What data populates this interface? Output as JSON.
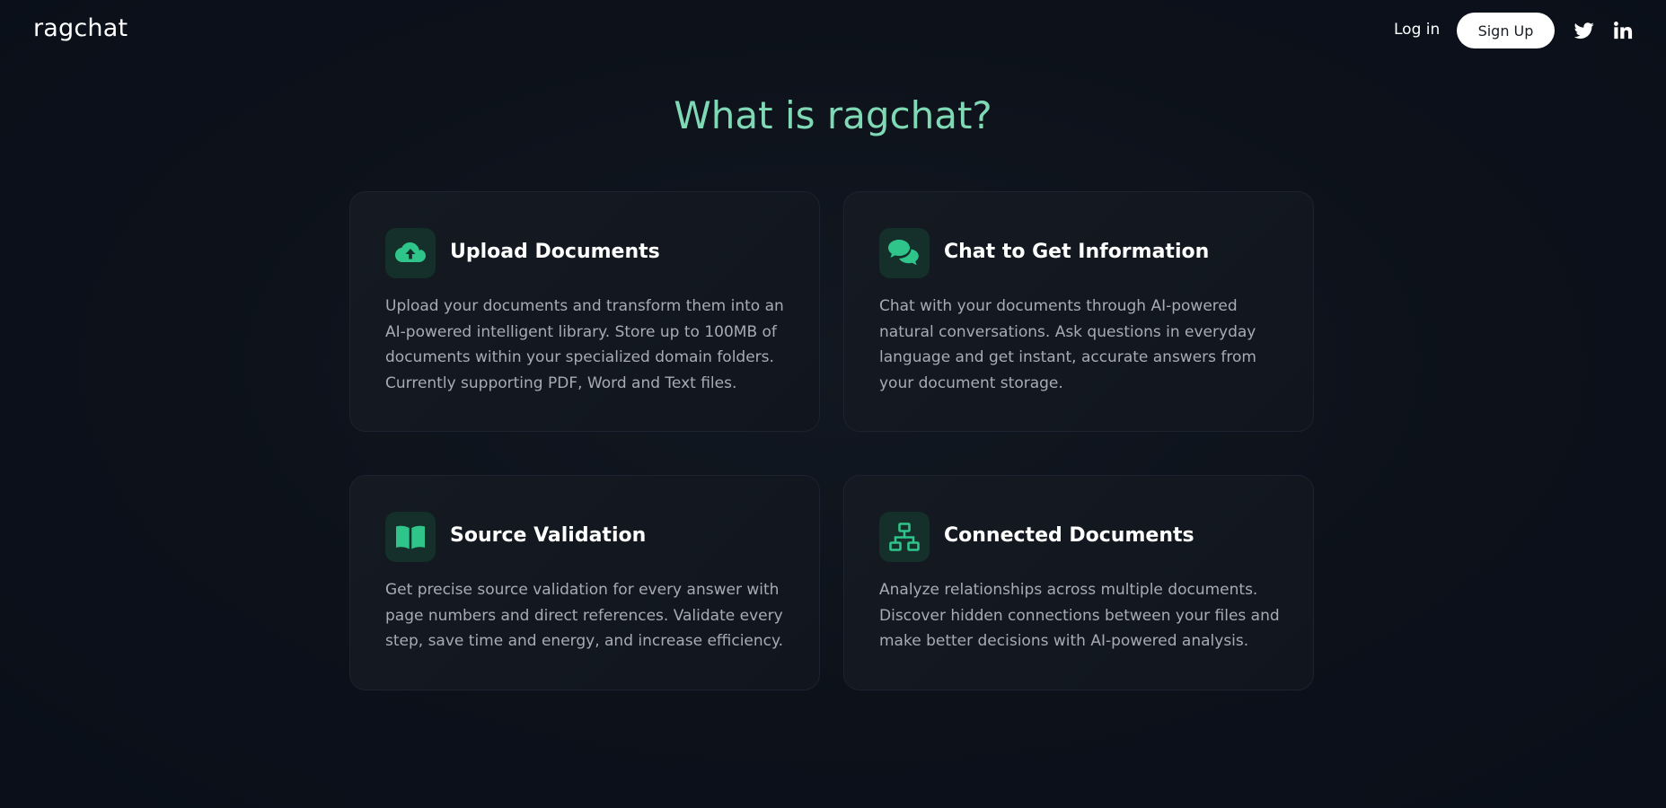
{
  "header": {
    "logo": "ragchat",
    "login_label": "Log in",
    "signup_label": "Sign Up",
    "social_icons": [
      "twitter-icon",
      "linkedin-icon"
    ]
  },
  "section": {
    "title": "What is ragchat?"
  },
  "colors": {
    "accent": "#7fd9b5",
    "icon_green": "#2ec48a",
    "icon_bg": "#15302a",
    "background": "#0b101a",
    "card_bg": "#151a22",
    "body_text": "#a6abb4"
  },
  "features": [
    {
      "icon": "cloud-upload-icon",
      "title": "Upload Documents",
      "text": "Upload your documents and transform them into an AI-powered intelligent library. Store up to 100MB of documents within your specialized domain folders. Currently supporting PDF, Word and Text files."
    },
    {
      "icon": "chat-bubbles-icon",
      "title": "Chat to Get Information",
      "text": "Chat with your documents through AI-powered natural conversations. Ask questions in everyday language and get instant, accurate answers from your document storage."
    },
    {
      "icon": "open-book-icon",
      "title": "Source Validation",
      "text": "Get precise source validation for every answer with page numbers and direct references. Validate every step, save time and energy, and increase efficiency."
    },
    {
      "icon": "network-icon",
      "title": "Connected Documents",
      "text": "Analyze relationships across multiple documents. Discover hidden connections between your files and make better decisions with AI-powered analysis."
    }
  ]
}
